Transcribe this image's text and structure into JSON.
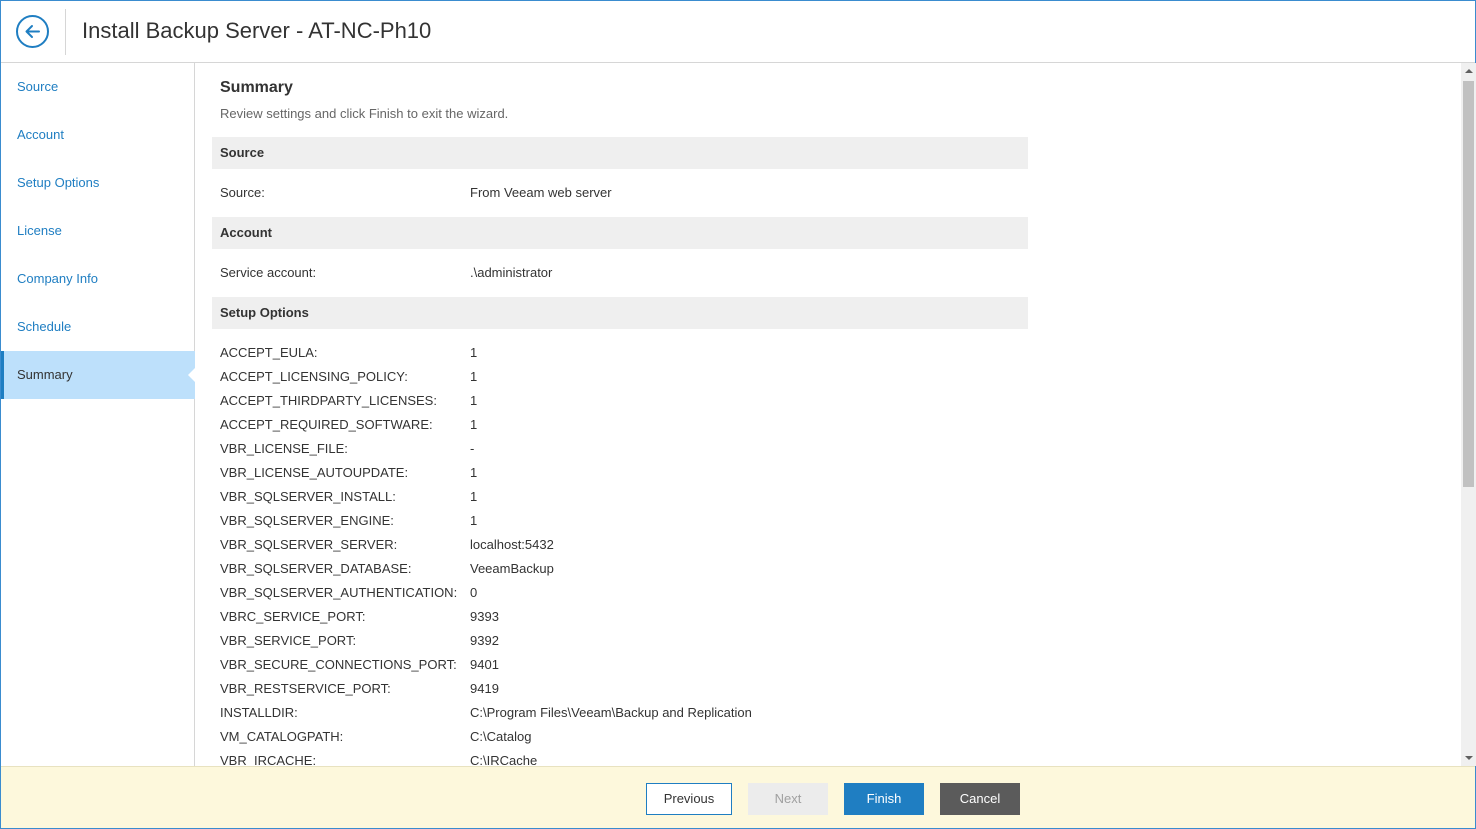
{
  "window": {
    "title": "Install Backup Server - AT-NC-Ph10"
  },
  "sidebar": {
    "items": [
      {
        "label": "Source",
        "active": false
      },
      {
        "label": "Account",
        "active": false
      },
      {
        "label": "Setup Options",
        "active": false
      },
      {
        "label": "License",
        "active": false
      },
      {
        "label": "Company Info",
        "active": false
      },
      {
        "label": "Schedule",
        "active": false
      },
      {
        "label": "Summary",
        "active": true
      }
    ]
  },
  "main": {
    "title": "Summary",
    "subtitle": "Review settings and click Finish to exit the wizard.",
    "sections": {
      "source": {
        "heading": "Source",
        "rows": [
          {
            "key": "Source:",
            "value": "From Veeam web server"
          }
        ]
      },
      "account": {
        "heading": "Account",
        "rows": [
          {
            "key": "Service account:",
            "value": ".\\administrator"
          }
        ]
      },
      "setup_options": {
        "heading": "Setup Options",
        "rows": [
          {
            "key": "ACCEPT_EULA:",
            "value": "1"
          },
          {
            "key": "ACCEPT_LICENSING_POLICY:",
            "value": "1"
          },
          {
            "key": "ACCEPT_THIRDPARTY_LICENSES:",
            "value": "1"
          },
          {
            "key": "ACCEPT_REQUIRED_SOFTWARE:",
            "value": "1"
          },
          {
            "key": "VBR_LICENSE_FILE:",
            "value": "-"
          },
          {
            "key": "VBR_LICENSE_AUTOUPDATE:",
            "value": "1"
          },
          {
            "key": "VBR_SQLSERVER_INSTALL:",
            "value": "1"
          },
          {
            "key": "VBR_SQLSERVER_ENGINE:",
            "value": "1"
          },
          {
            "key": "VBR_SQLSERVER_SERVER:",
            "value": "localhost:5432"
          },
          {
            "key": "VBR_SQLSERVER_DATABASE:",
            "value": "VeeamBackup"
          },
          {
            "key": "VBR_SQLSERVER_AUTHENTICATION:",
            "value": "0"
          },
          {
            "key": "VBRC_SERVICE_PORT:",
            "value": "9393"
          },
          {
            "key": "VBR_SERVICE_PORT:",
            "value": "9392"
          },
          {
            "key": "VBR_SECURE_CONNECTIONS_PORT:",
            "value": "9401"
          },
          {
            "key": "VBR_RESTSERVICE_PORT:",
            "value": "9419"
          },
          {
            "key": "INSTALLDIR:",
            "value": "C:\\Program Files\\Veeam\\Backup and Replication"
          },
          {
            "key": "VM_CATALOGPATH:",
            "value": "C:\\Catalog"
          },
          {
            "key": "VBR_IRCACHE:",
            "value": "C:\\IRCache"
          }
        ]
      }
    }
  },
  "footer": {
    "previous_label": "Previous",
    "next_label": "Next",
    "finish_label": "Finish",
    "cancel_label": "Cancel"
  },
  "colors": {
    "accent": "#1f7ec2",
    "active_nav_bg": "#bde0fb",
    "footer_bg": "#fdf8dc",
    "section_bg": "#efefef",
    "cancel_bg": "#5b5b5b"
  },
  "icons": {
    "back": "arrow-left-circle-icon"
  }
}
